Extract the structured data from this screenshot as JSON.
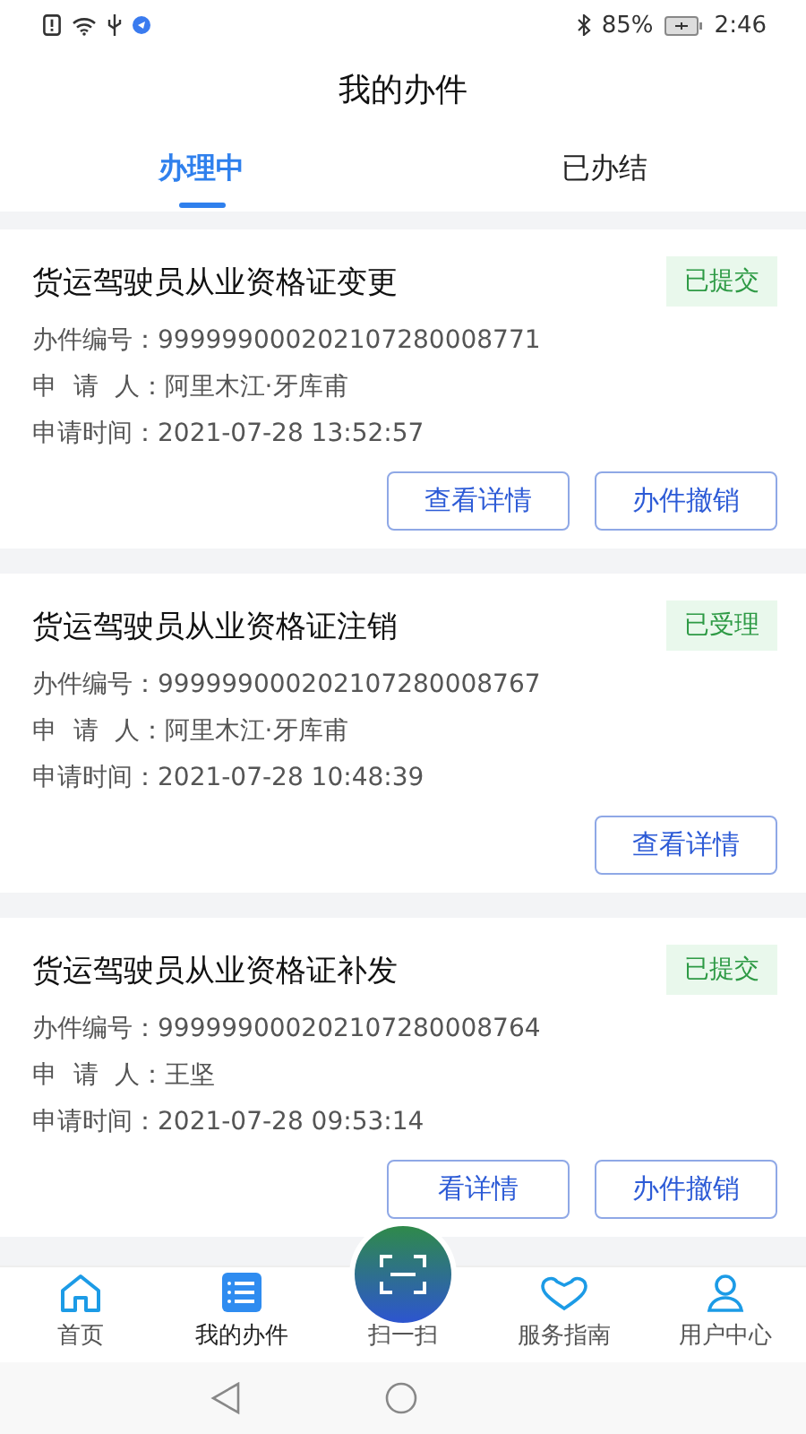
{
  "status_bar": {
    "battery": "85%",
    "time": "2:46"
  },
  "header": {
    "title": "我的办件"
  },
  "tabs": [
    {
      "label": "办理中",
      "selected": true
    },
    {
      "label": "已办结",
      "selected": false
    }
  ],
  "cases": [
    {
      "title": "货运驾驶员从业资格证变更",
      "status": "已提交",
      "lines": [
        "办件编号：999999000202107280008771",
        "申  请  人：阿里木江·牙库甫",
        "申请时间：2021-07-28 13:52:57"
      ],
      "buttons": [
        "查看详情",
        "办件撤销"
      ]
    },
    {
      "title": "货运驾驶员从业资格证注销",
      "status": "已受理",
      "lines": [
        "办件编号：999999000202107280008767",
        "申  请  人：阿里木江·牙库甫",
        "申请时间：2021-07-28 10:48:39"
      ],
      "buttons": [
        "查看详情"
      ]
    },
    {
      "title": "货运驾驶员从业资格证补发",
      "status": "已提交",
      "lines": [
        "办件编号：999999000202107280008764",
        "申  请  人：王坚",
        "申请时间：2021-07-28 09:53:14"
      ],
      "buttons": [
        "看详情",
        "办件撤销"
      ]
    }
  ],
  "nav": [
    {
      "kind": "home",
      "label": "首页",
      "selected": false
    },
    {
      "kind": "cases",
      "label": "我的办件",
      "selected": true
    },
    {
      "kind": "scan",
      "label": "扫一扫",
      "selected": false
    },
    {
      "kind": "guide",
      "label": "服务指南",
      "selected": false
    },
    {
      "kind": "user",
      "label": "用户中心",
      "selected": false
    }
  ]
}
